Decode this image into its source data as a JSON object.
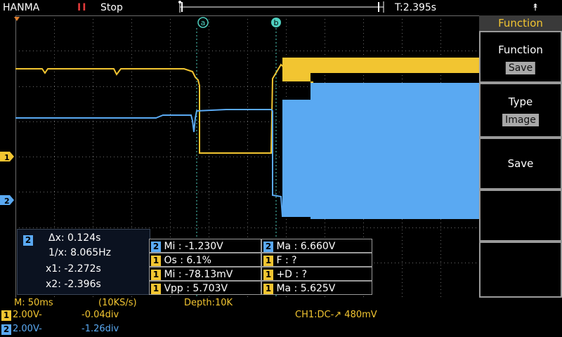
{
  "topbar": {
    "brand": "HANMA",
    "run_icon": "II",
    "run_state": "Stop",
    "trigger_time": "T:2.395s",
    "usb_icon": "usb-icon"
  },
  "cursors": {
    "a_label": "a",
    "b_label": "b"
  },
  "channel_markers": {
    "ch1": "1",
    "ch2": "2"
  },
  "menu": {
    "title": "Function",
    "items": [
      {
        "label": "Function",
        "value": "Save"
      },
      {
        "label": "Type",
        "value": "Image"
      },
      {
        "label": "Save",
        "value": ""
      }
    ]
  },
  "cursor_panel": {
    "channel": "2",
    "dx": "Δx: 0.124s",
    "inv": "1/x: 8.065Hz",
    "x1": "x1: -2.272s",
    "x2": "x2: -2.396s"
  },
  "measurements": [
    {
      "ch": "2",
      "text": "Mi : -1.230V"
    },
    {
      "ch": "2",
      "text": "Ma : 6.660V"
    },
    {
      "ch": "1",
      "text": "Os : 6.1%"
    },
    {
      "ch": "1",
      "text": "F :    ?"
    },
    {
      "ch": "1",
      "text": "Mi : -78.13mV"
    },
    {
      "ch": "1",
      "text": "+D :    ?"
    },
    {
      "ch": "1",
      "text": "Vpp : 5.703V"
    },
    {
      "ch": "1",
      "text": "Ma : 5.625V"
    }
  ],
  "bottom": {
    "timebase": "M: 50ms",
    "sample_rate": "(10KS/s)",
    "depth": "Depth:10K",
    "ch1_num": "1",
    "ch1_scale": "2.00V-",
    "ch1_offset": "-0.04div",
    "ch2_num": "2",
    "ch2_scale": "2.00V-",
    "ch2_offset": "-1.26div",
    "trigger": "CH1:DC-↗ 480mV"
  },
  "colors": {
    "ch1": "#f2c531",
    "ch2": "#5aa9f2",
    "grid": "#6b6b6b",
    "cursor": "#4fd0c0"
  }
}
